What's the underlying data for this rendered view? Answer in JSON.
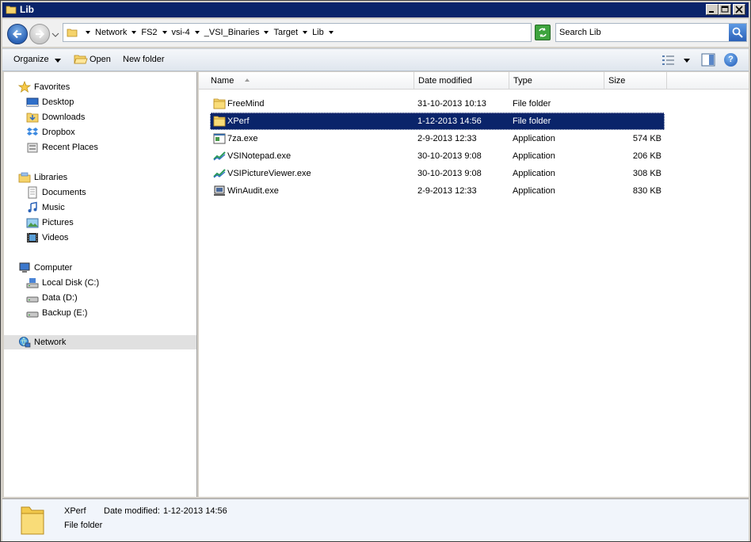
{
  "window": {
    "title": "Lib"
  },
  "address": {
    "crumbs": [
      "Network",
      "FS2",
      "vsi-4",
      "_VSI_Binaries",
      "Target",
      "Lib"
    ],
    "search_placeholder": "Search Lib"
  },
  "toolbar": {
    "organize_label": "Organize",
    "open_label": "Open",
    "new_folder_label": "New folder"
  },
  "navigation": {
    "favorites": {
      "label": "Favorites",
      "items": [
        "Desktop",
        "Downloads",
        "Dropbox",
        "Recent Places"
      ]
    },
    "libraries": {
      "label": "Libraries",
      "items": [
        "Documents",
        "Music",
        "Pictures",
        "Videos"
      ]
    },
    "computer": {
      "label": "Computer",
      "items": [
        "Local Disk (C:)",
        "Data (D:)",
        "Backup (E:)"
      ]
    },
    "network": {
      "label": "Network"
    }
  },
  "columns": {
    "name": "Name",
    "date": "Date modified",
    "type": "Type",
    "size": "Size"
  },
  "files": [
    {
      "name": "FreeMind",
      "date": "31-10-2013 10:13",
      "type": "File folder",
      "size": "",
      "icon": "folder-icon"
    },
    {
      "name": "XPerf",
      "date": "1-12-2013 14:56",
      "type": "File folder",
      "size": "",
      "icon": "folder-icon",
      "selected": true
    },
    {
      "name": "7za.exe",
      "date": "2-9-2013 12:33",
      "type": "Application",
      "size": "574 KB",
      "icon": "console-app-icon"
    },
    {
      "name": "VSINotepad.exe",
      "date": "30-10-2013 9:08",
      "type": "Application",
      "size": "206 KB",
      "icon": "vsi-app-icon"
    },
    {
      "name": "VSIPictureViewer.exe",
      "date": "30-10-2013 9:08",
      "type": "Application",
      "size": "308 KB",
      "icon": "vsi-app-icon"
    },
    {
      "name": "WinAudit.exe",
      "date": "2-9-2013 12:33",
      "type": "Application",
      "size": "830 KB",
      "icon": "computer-app-icon"
    }
  ],
  "details": {
    "name": "XPerf",
    "date_label": "Date modified:",
    "date_value": "1-12-2013 14:56",
    "type": "File folder"
  },
  "colors": {
    "title_bar": "#0a246a",
    "selection": "#0a246a",
    "window_frame": "#d4d0c8",
    "folder_yellow": "#f5d36b"
  }
}
